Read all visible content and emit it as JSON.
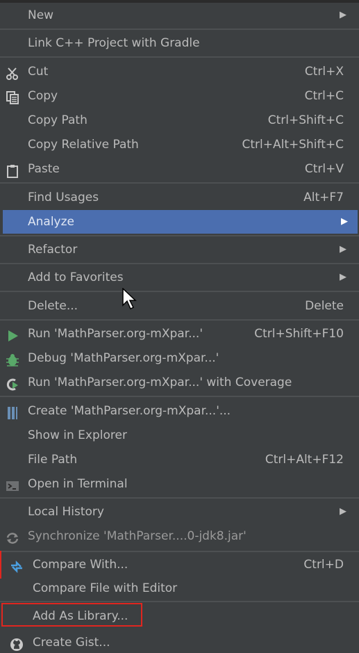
{
  "menu": {
    "items": [
      {
        "id": "new",
        "label": "New",
        "shortcut": "",
        "submenu": true
      },
      {
        "id": "link-cpp",
        "label": "Link C++ Project with Gradle",
        "shortcut": ""
      },
      {
        "id": "cut",
        "label": "Cut",
        "shortcut": "Ctrl+X",
        "icon": "scissors-icon"
      },
      {
        "id": "copy",
        "label": "Copy",
        "shortcut": "Ctrl+C",
        "icon": "copy-icon"
      },
      {
        "id": "copy-path",
        "label": "Copy Path",
        "shortcut": "Ctrl+Shift+C"
      },
      {
        "id": "copy-relative-path",
        "label": "Copy Relative Path",
        "shortcut": "Ctrl+Alt+Shift+C"
      },
      {
        "id": "paste",
        "label": "Paste",
        "shortcut": "Ctrl+V",
        "icon": "clipboard-icon"
      },
      {
        "id": "find-usages",
        "label": "Find Usages",
        "shortcut": "Alt+F7"
      },
      {
        "id": "analyze",
        "label": "Analyze",
        "shortcut": "",
        "submenu": true,
        "selected": true
      },
      {
        "id": "refactor",
        "label": "Refactor",
        "shortcut": "",
        "submenu": true
      },
      {
        "id": "add-to-favorites",
        "label": "Add to Favorites",
        "shortcut": "",
        "submenu": true
      },
      {
        "id": "delete",
        "label": "Delete...",
        "shortcut": "Delete"
      },
      {
        "id": "run",
        "label": "Run 'MathParser.org-mXpar...'",
        "shortcut": "Ctrl+Shift+F10",
        "icon": "run-icon"
      },
      {
        "id": "debug",
        "label": "Debug 'MathParser.org-mXpar...'",
        "shortcut": "",
        "icon": "bug-icon"
      },
      {
        "id": "run-coverage",
        "label": "Run 'MathParser.org-mXpar...' with Coverage",
        "shortcut": "",
        "icon": "coverage-icon"
      },
      {
        "id": "create",
        "label": "Create 'MathParser.org-mXpar...'...",
        "shortcut": "",
        "icon": "config-icon"
      },
      {
        "id": "show-in-explorer",
        "label": "Show in Explorer",
        "shortcut": ""
      },
      {
        "id": "file-path",
        "label": "File Path",
        "shortcut": "Ctrl+Alt+F12"
      },
      {
        "id": "open-terminal",
        "label": "Open in Terminal",
        "shortcut": "",
        "icon": "terminal-icon"
      },
      {
        "id": "local-history",
        "label": "Local History",
        "shortcut": "",
        "submenu": true
      },
      {
        "id": "synchronize",
        "label": "Synchronize 'MathParser....0-jdk8.jar'",
        "shortcut": "",
        "icon": "sync-icon",
        "disabled": true
      },
      {
        "id": "compare-with",
        "label": "Compare With...",
        "shortcut": "Ctrl+D",
        "icon": "compare-icon"
      },
      {
        "id": "compare-file-editor",
        "label": "Compare File with Editor",
        "shortcut": ""
      },
      {
        "id": "add-as-library",
        "label": "Add As Library...",
        "shortcut": ""
      },
      {
        "id": "create-gist",
        "label": "Create Gist...",
        "shortcut": "",
        "icon": "github-icon"
      }
    ],
    "submenu_arrow": "▶"
  },
  "colors": {
    "background": "#3c3f41",
    "selected": "#4b6eaf",
    "highlight_box": "#e0261f"
  }
}
